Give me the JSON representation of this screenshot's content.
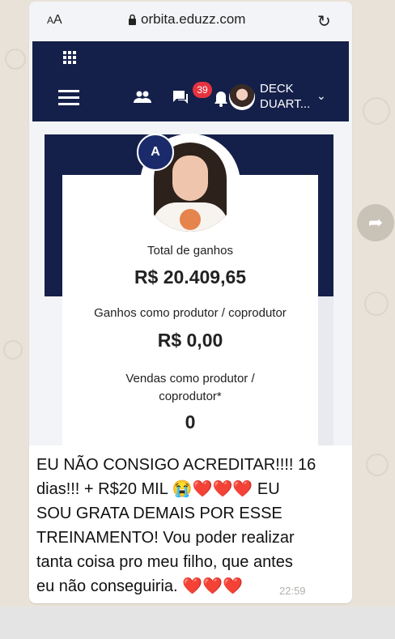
{
  "browser": {
    "text_size": "AA",
    "url": "orbita.eduzz.com",
    "reload_icon": "reload-icon"
  },
  "app_header": {
    "apps_icon": "grid-icon",
    "menu_icon": "hamburger-icon",
    "users_icon": "users-icon",
    "chat_icon": "chat-icon",
    "bell_icon": "bell-icon",
    "notification_count": "39",
    "user_name_line1": "DECK",
    "user_name_line2": "DUART...",
    "dropdown_icon": "chevron-down-icon",
    "colors": {
      "header_bg": "#15204a",
      "badge": "#e53340"
    }
  },
  "profile_card": {
    "total_label": "Total de ganhos",
    "total_value": "R$ 20.409,65",
    "producer_label": "Ganhos como produtor / coprodutor",
    "producer_value": "R$ 0,00",
    "sales_label_line1": "Vendas como produtor /",
    "sales_label_line2": "coprodutor*",
    "sales_value": "0"
  },
  "message": {
    "line1": "EU NÃO CONSIGO ACREDITAR!!!! 16",
    "line2_a": "dias!!! + R$20 MIL ",
    "line2_emoji": "😭",
    "line2_hearts": "❤️❤️❤️",
    "line2_b": " EU",
    "line3": "SOU GRATA DEMAIS POR ESSE",
    "line4": "TREINAMENTO! Vou poder realizar",
    "line5": "tanta coisa pro meu filho, que antes",
    "line6_a": "eu não conseguiria. ",
    "line6_hearts": "❤️❤️❤️",
    "time": "22:59"
  },
  "chat": {
    "forward_icon": "forward-icon"
  }
}
